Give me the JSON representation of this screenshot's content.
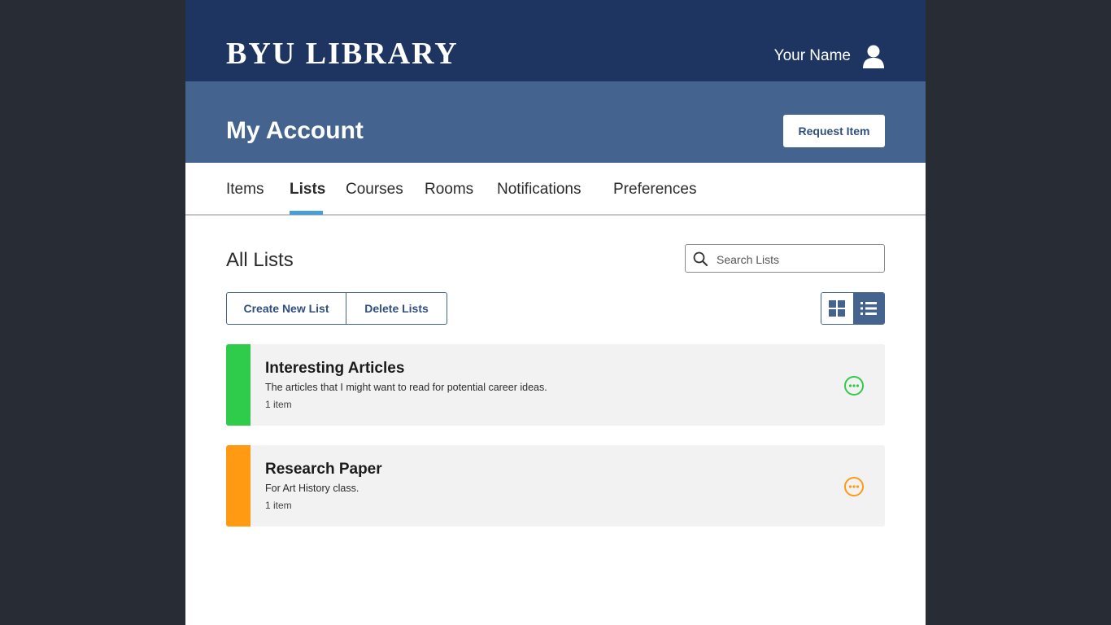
{
  "header": {
    "logo": "BYU LIBRARY",
    "user_name": "Your Name"
  },
  "account": {
    "title": "My Account",
    "request_button": "Request Item"
  },
  "tabs": [
    {
      "label": "Items",
      "active": false
    },
    {
      "label": "Lists",
      "active": true
    },
    {
      "label": "Courses",
      "active": false
    },
    {
      "label": "Rooms",
      "active": false
    },
    {
      "label": "Notifications",
      "active": false
    },
    {
      "label": "Preferences",
      "active": false
    }
  ],
  "lists_section": {
    "heading": "All Lists",
    "search_placeholder": "Search Lists",
    "create_button": "Create New List",
    "delete_button": "Delete Lists",
    "view_mode": "list"
  },
  "lists": [
    {
      "title": "Interesting Articles",
      "description": "The articles that I might want to read for potential career ideas.",
      "count": "1 item",
      "color": "#2ecc4a",
      "icon": "more-options-icon"
    },
    {
      "title": "Research Paper",
      "description": "For Art History class.",
      "count": "1 item",
      "color": "#ff9a12",
      "icon": "more-options-icon"
    }
  ],
  "colors": {
    "topbar": "#1f3561",
    "account_bar": "#44638f",
    "tab_accent": "#4a9ed8",
    "background": "#282c34"
  }
}
